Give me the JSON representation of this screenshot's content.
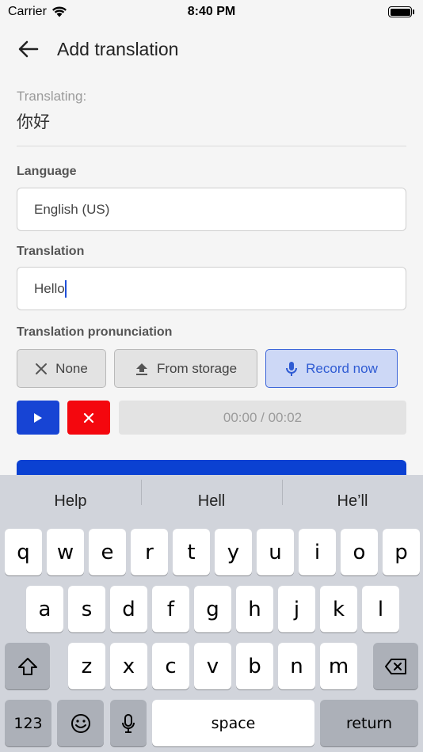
{
  "status_bar": {
    "carrier": "Carrier",
    "time": "8:40 PM"
  },
  "header": {
    "title": "Add translation"
  },
  "translating": {
    "label": "Translating:",
    "value": "你好"
  },
  "language": {
    "label": "Language",
    "value": "English (US)"
  },
  "translation": {
    "label": "Translation",
    "value": "Hello"
  },
  "pronunciation": {
    "label": "Translation pronunciation",
    "options": [
      "None",
      "From storage",
      "Record now"
    ],
    "selected": "Record now"
  },
  "playback": {
    "time": "00:00 / 00:02"
  },
  "keyboard": {
    "suggestions": [
      "Help",
      "Hell",
      "He’ll"
    ],
    "row1": [
      "q",
      "w",
      "e",
      "r",
      "t",
      "y",
      "u",
      "i",
      "o",
      "p"
    ],
    "row2": [
      "a",
      "s",
      "d",
      "f",
      "g",
      "h",
      "j",
      "k",
      "l"
    ],
    "row3": [
      "z",
      "x",
      "c",
      "v",
      "b",
      "n",
      "m"
    ],
    "numbers_label": "123",
    "space_label": "space",
    "return_label": "return"
  },
  "colors": {
    "accent": "#1744d4",
    "danger": "#f4070e",
    "selected_bg": "#cdd8f6"
  }
}
